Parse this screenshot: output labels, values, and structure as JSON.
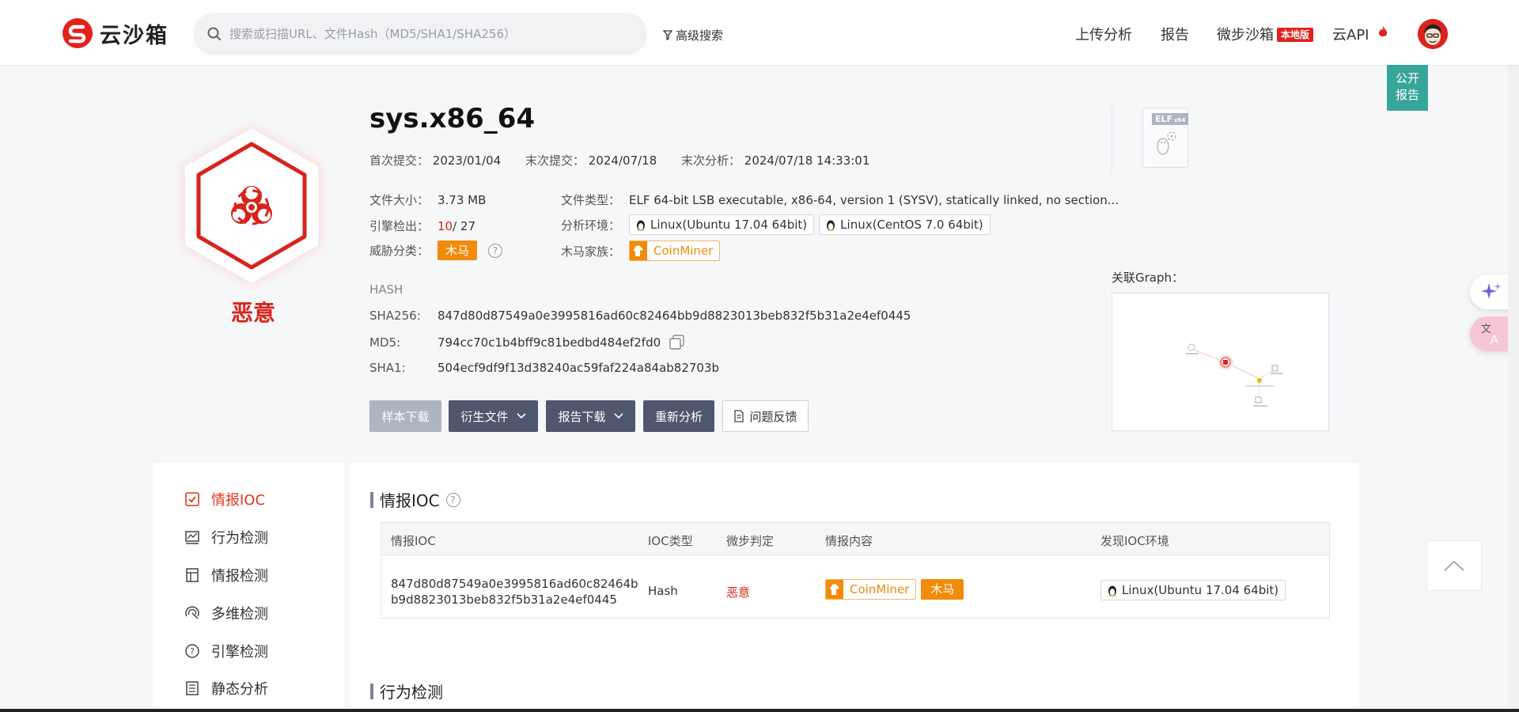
{
  "header": {
    "logo_text": "云沙箱",
    "search_placeholder": "搜索或扫描URL、文件Hash（MD5/SHA1/SHA256）",
    "advanced_search": "高级搜索",
    "nav": {
      "upload": "上传分析",
      "report": "报告",
      "sandbox": "微步沙箱",
      "sandbox_badge": "本地版",
      "api": "云API"
    }
  },
  "public_report": [
    "公开",
    "报告"
  ],
  "verdict": "恶意",
  "file": {
    "name": "sys.x86_64",
    "first_submit_label": "首次提交：",
    "first_submit": "2023/01/04",
    "last_submit_label": "末次提交：",
    "last_submit": "2024/07/18",
    "last_analysis_label": "末次分析：",
    "last_analysis": "2024/07/18 14:33:01",
    "size_label": "文件大小：",
    "size": "3.73 MB",
    "type_label": "文件类型：",
    "type": "ELF 64-bit LSB executable, x86-64, version 1 (SYSV), statically linked, no section...",
    "engine_label": "引擎检出：",
    "engine_hits": "10",
    "engine_total": " / 27",
    "env_label": "分析环境：",
    "envs": [
      "Linux(Ubuntu 17.04 64bit)",
      "Linux(CentOS 7.0 64bit)"
    ],
    "threat_label": "威胁分类：",
    "threat": "木马",
    "family_label": "木马家族：",
    "family": "CoinMiner",
    "elf_badge": "ELF",
    "elf_suffix": "x64"
  },
  "hash": {
    "heading": "HASH",
    "sha256_label": "SHA256:",
    "sha256": "847d80d87549a0e3995816ad60c82464bb9d8823013beb832f5b31a2e4ef0445",
    "md5_label": "MD5:",
    "md5": "794cc70c1b4bff9c81bedbd484ef2fd0",
    "sha1_label": "SHA1:",
    "sha1": "504ecf9df9f13d38240ac59faf224a84ab82703b"
  },
  "actions": {
    "sample_download": "样本下载",
    "derived_files": "衍生文件",
    "report_download": "报告下载",
    "reanalyze": "重新分析",
    "feedback": "问题反馈"
  },
  "graph_label": "关联Graph：",
  "sidebar": [
    {
      "label": "情报IOC",
      "icon": "ioc-check-icon"
    },
    {
      "label": "行为检测",
      "icon": "chart-icon"
    },
    {
      "label": "情报检测",
      "icon": "layout-icon"
    },
    {
      "label": "多维检测",
      "icon": "radar-icon"
    },
    {
      "label": "引擎检测",
      "icon": "engine-icon"
    },
    {
      "label": "静态分析",
      "icon": "list-doc-icon"
    }
  ],
  "ioc_section": {
    "title": "情报IOC",
    "columns": [
      "情报IOC",
      "IOC类型",
      "微步判定",
      "情报内容",
      "发现IOC环境"
    ],
    "row": {
      "ioc_line1": "847d80d87549a0e3995816ad60c82464b",
      "ioc_line2": "b9d8823013beb832f5b31a2e4ef0445",
      "type": "Hash",
      "verdict": "恶意",
      "family": "CoinMiner",
      "threat": "木马",
      "env": "Linux(Ubuntu 17.04 64bit)"
    }
  },
  "behavior_section": {
    "title": "行为检测"
  },
  "colors": {
    "brand_red": "#e3211a",
    "malicious_red": "#d8231b",
    "trojan_orange": "#f08c0a",
    "teal": "#38a59a",
    "dark_button": "#50566d"
  }
}
